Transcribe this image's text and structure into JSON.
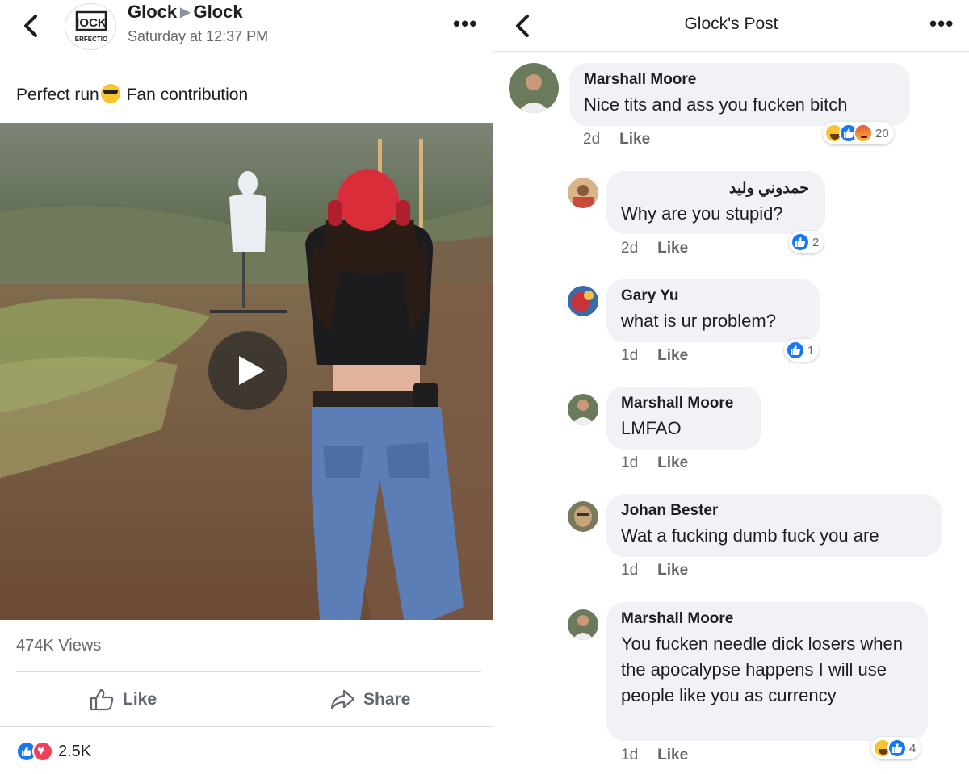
{
  "left": {
    "page_name": "Glock",
    "target_name": "Glock",
    "timestamp": "Saturday at 12:37 PM",
    "logo_text_top": "lOCK",
    "logo_text_bottom": "ERFECTIO",
    "post_text_before": "Perfect run",
    "post_text_after": "Fan contribution",
    "views": "474K Views",
    "like_label": "Like",
    "share_label": "Share",
    "reaction_count": "2.5K",
    "reaction_types": [
      "like-icon",
      "love-icon"
    ]
  },
  "right": {
    "title": "Glock's Post",
    "comments": [
      {
        "name": "Marshall Moore",
        "text": "Nice tits and ass you fucken bitch",
        "age": "2d",
        "like": "Like",
        "reactions": [
          "haha-icon",
          "like-icon",
          "angry-icon"
        ],
        "reaction_count": "20"
      },
      {
        "name": "حمدوني وليد",
        "text": "Why are you stupid?",
        "age": "2d",
        "like": "Like",
        "reactions": [
          "like-icon"
        ],
        "reaction_count": "2"
      },
      {
        "name": "Gary Yu",
        "text": "what is ur problem?",
        "age": "1d",
        "like": "Like",
        "reactions": [
          "like-icon"
        ],
        "reaction_count": "1"
      },
      {
        "name": "Marshall Moore",
        "text": "LMFAO",
        "age": "1d",
        "like": "Like"
      },
      {
        "name": "Johan Bester",
        "text": "Wat a fucking dumb fuck you are",
        "age": "1d",
        "like": "Like"
      },
      {
        "name": "Marshall Moore",
        "text": "You fucken needle dick losers when the apocalypse happens I will use people like you as currency",
        "age": "1d",
        "like": "Like",
        "reactions": [
          "haha-icon",
          "like-icon"
        ],
        "reaction_count": "4"
      }
    ]
  },
  "colors": {
    "facebook_blue": "#1877f2",
    "bubble_gray": "#f0f2f5",
    "meta_gray": "#65676b"
  }
}
